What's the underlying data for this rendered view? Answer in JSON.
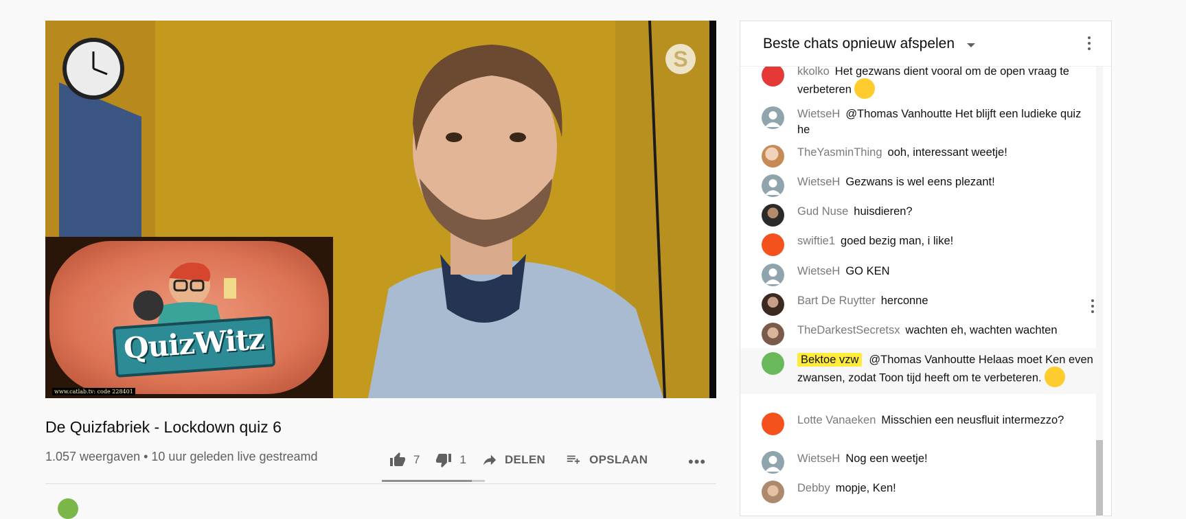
{
  "video": {
    "pip_logo_text": "QuizWitz",
    "pip_caption": "www.catlab.tv: code 228401",
    "overlay_icon": "skype-icon",
    "title": "De Quizfabriek - Lockdown quiz 6",
    "meta": "1.057 weergaven • 10 uur geleden live gestreamd",
    "likes": "7",
    "dislikes": "1",
    "like_ratio": 0.875,
    "share_label": "DELEN",
    "save_label": "OPSLAAN",
    "more_label": "•••"
  },
  "chat": {
    "title": "Beste chats opnieuw afspelen",
    "messages": [
      {
        "author": "kkolko",
        "text": "Het gezwans dient vooral om de open vraag te verbeteren",
        "emoji": "wink-emoji"
      },
      {
        "author": "WietseH",
        "text": "@Thomas Vanhoutte Het blijft een ludieke quiz he"
      },
      {
        "author": "TheYasminThing",
        "text": "ooh, interessant weetje!"
      },
      {
        "author": "WietseH",
        "text": "Gezwans is wel eens plezant!"
      },
      {
        "author": "Gud Nuse",
        "text": "huisdieren?"
      },
      {
        "author": "swiftie1",
        "text": "goed bezig man, i like!"
      },
      {
        "author": "WietseH",
        "text": "GO KEN"
      },
      {
        "author": "Bart De Ruytter",
        "text": "herconne"
      },
      {
        "author": "TheDarkestSecretsx",
        "text": "wachten eh, wachten wachten"
      },
      {
        "author": "Bektoe vzw",
        "text": "@Thomas Vanhoutte Helaas moet Ken even zwansen, zodat Toon tijd heeft om te verbeteren.",
        "emoji": "tongue-emoji"
      },
      {
        "author": "Lotte Vanaeken",
        "text": "Misschien een neusfluit intermezzo?"
      },
      {
        "author": "WietseH",
        "text": "Nog een weetje!"
      },
      {
        "author": "Debby",
        "text": "mopje, Ken!"
      }
    ]
  }
}
